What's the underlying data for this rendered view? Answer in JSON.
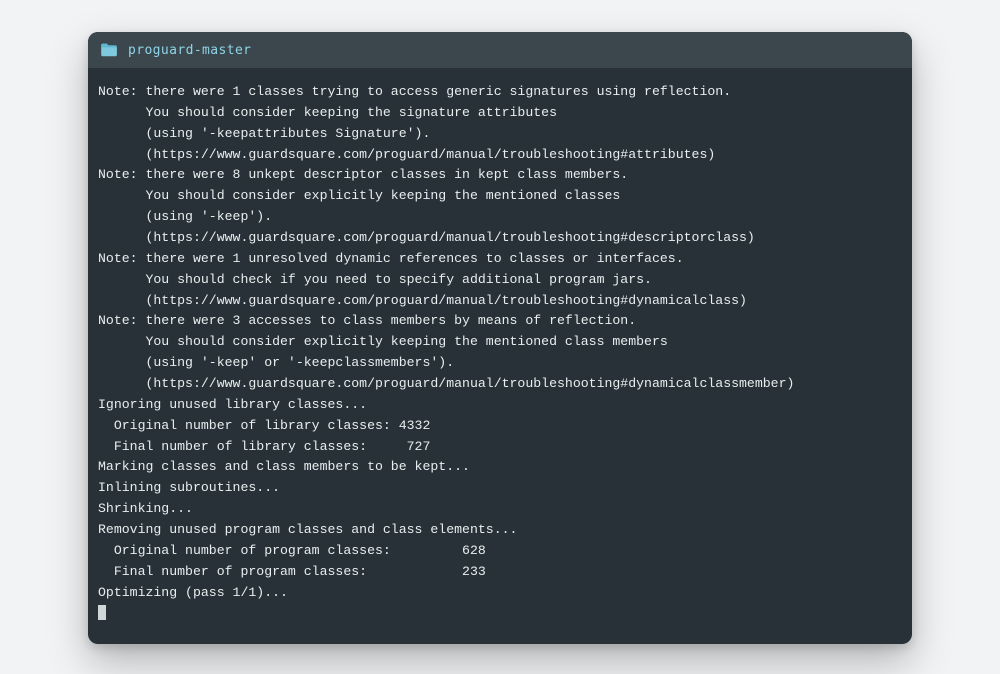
{
  "colors": {
    "page_bg": "#f1f3f5",
    "window_bg": "#273137",
    "titlebar_bg": "#3b464d",
    "title_fg": "#8fd4e8",
    "terminal_fg": "#e8eef0",
    "folder_icon": "#7fc9df",
    "cursor": "#cfd7d9"
  },
  "titlebar": {
    "folder_icon": "folder-icon",
    "title": "proguard-master"
  },
  "terminal": {
    "lines": [
      "Note: there were 1 classes trying to access generic signatures using reflection.",
      "      You should consider keeping the signature attributes",
      "      (using '-keepattributes Signature').",
      "      (https://www.guardsquare.com/proguard/manual/troubleshooting#attributes)",
      "Note: there were 8 unkept descriptor classes in kept class members.",
      "      You should consider explicitly keeping the mentioned classes",
      "      (using '-keep').",
      "      (https://www.guardsquare.com/proguard/manual/troubleshooting#descriptorclass)",
      "Note: there were 1 unresolved dynamic references to classes or interfaces.",
      "      You should check if you need to specify additional program jars.",
      "      (https://www.guardsquare.com/proguard/manual/troubleshooting#dynamicalclass)",
      "Note: there were 3 accesses to class members by means of reflection.",
      "      You should consider explicitly keeping the mentioned class members",
      "      (using '-keep' or '-keepclassmembers').",
      "      (https://www.guardsquare.com/proguard/manual/troubleshooting#dynamicalclassmember)",
      "Ignoring unused library classes...",
      "  Original number of library classes: 4332",
      "  Final number of library classes:     727",
      "Marking classes and class members to be kept...",
      "Inlining subroutines...",
      "Shrinking...",
      "Removing unused program classes and class elements...",
      "  Original number of program classes:         628",
      "  Final number of program classes:            233",
      "Optimizing (pass 1/1)..."
    ]
  }
}
